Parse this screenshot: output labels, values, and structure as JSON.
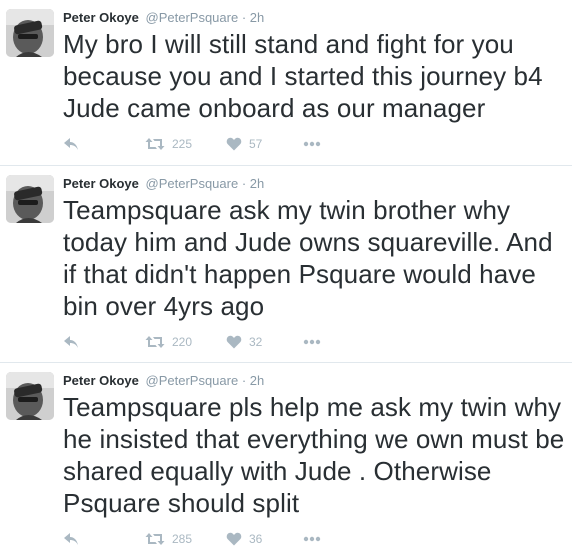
{
  "tweets": [
    {
      "name": "Peter Okoye",
      "handle": "@PeterPsquare",
      "separator": "·",
      "time": "2h",
      "text": "My bro I will still stand and fight for you because you and I started this journey b4 Jude came onboard as our manager",
      "retweets": "225",
      "likes": "57"
    },
    {
      "name": "Peter Okoye",
      "handle": "@PeterPsquare",
      "separator": "·",
      "time": "2h",
      "text": "Teampsquare ask my twin brother why today him and Jude owns squareville. And if that didn't happen Psquare would have bin over 4yrs ago",
      "retweets": "220",
      "likes": "32"
    },
    {
      "name": "Peter Okoye",
      "handle": "@PeterPsquare",
      "separator": "·",
      "time": "2h",
      "text": "Teampsquare pls help me ask my twin why he insisted that everything we own must be shared equally with Jude . Otherwise Psquare should split",
      "retweets": "285",
      "likes": "36"
    }
  ],
  "icons": {
    "reply": "reply-icon",
    "retweet": "retweet-icon",
    "like": "heart-icon",
    "more": "more-icon"
  },
  "colors": {
    "text": "#292f33",
    "meta": "#8899a6",
    "icon": "#aab8c2",
    "divider": "#e1e8ed"
  }
}
